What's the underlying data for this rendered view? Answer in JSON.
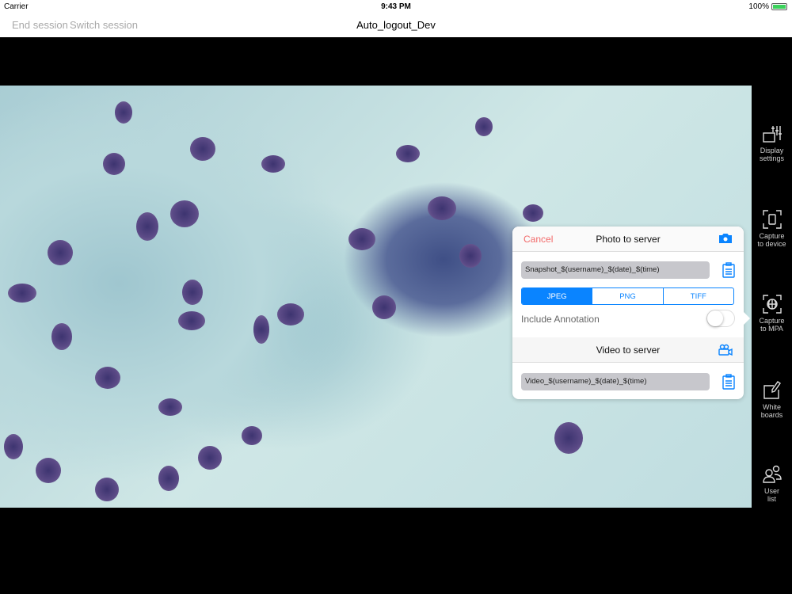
{
  "status": {
    "carrier": "Carrier",
    "time": "9:43 PM",
    "battery": "100%",
    "battery_level": 1.0
  },
  "nav": {
    "end_session": "End session",
    "switch_session": "Switch session",
    "title": "Auto_logout_Dev"
  },
  "sidebar": {
    "items": [
      {
        "label1": "Display",
        "label2": "settings",
        "icon": "sliders-icon"
      },
      {
        "label1": "Capture",
        "label2": "to device",
        "icon": "capture-device-icon"
      },
      {
        "label1": "Capture",
        "label2": "to MPA",
        "icon": "capture-globe-icon"
      },
      {
        "label1": "White",
        "label2": "boards",
        "icon": "whiteboard-icon"
      },
      {
        "label1": "User",
        "label2": "list",
        "icon": "users-icon"
      }
    ]
  },
  "popover": {
    "cancel": "Cancel",
    "photo_title": "Photo to server",
    "snapshot_name": "Snapshot_$(username)_$(date)_$(time)",
    "formats": [
      "JPEG",
      "PNG",
      "TIFF"
    ],
    "selected_format": "JPEG",
    "include_annotation": "Include Annotation",
    "include_annotation_on": false,
    "video_title": "Video to server",
    "video_name": "Video_$(username)_$(date)_$(time)"
  },
  "colors": {
    "accent": "#0a84ff",
    "cancel": "#f26a6a"
  }
}
